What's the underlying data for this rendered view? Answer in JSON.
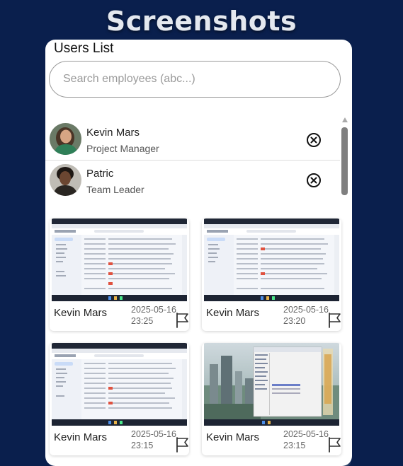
{
  "page": {
    "title": "Screenshots"
  },
  "users_panel": {
    "title": "Users List",
    "search": {
      "placeholder": "Search employees (abc...)",
      "value": ""
    },
    "users": [
      {
        "name": "Kevin Mars",
        "role": "Project Manager",
        "avatar": "female-avatar",
        "action_icon": "remove-circle-icon"
      },
      {
        "name": "Patric",
        "role": "Team Leader",
        "avatar": "male-avatar",
        "action_icon": "remove-circle-icon"
      }
    ]
  },
  "screenshots": [
    {
      "user": "Kevin Mars",
      "date": "2025-05-16",
      "time": "23:25",
      "thumbnail": "email-app-screenshot",
      "action_icon": "flag-icon"
    },
    {
      "user": "Kevin Mars",
      "date": "2025-05-16",
      "time": "23:20",
      "thumbnail": "email-app-screenshot",
      "action_icon": "flag-icon"
    },
    {
      "user": "Kevin Mars",
      "date": "2025-05-16",
      "time": "23:15",
      "thumbnail": "email-app-screenshot",
      "action_icon": "flag-icon"
    },
    {
      "user": "Kevin Mars",
      "date": "2025-05-16",
      "time": "23:15",
      "thumbnail": "desktop-file-explorer-screenshot",
      "action_icon": "flag-icon"
    }
  ],
  "colors": {
    "background": "#0a1f4d",
    "panel": "#ffffff",
    "title": "#e4e8ef"
  }
}
